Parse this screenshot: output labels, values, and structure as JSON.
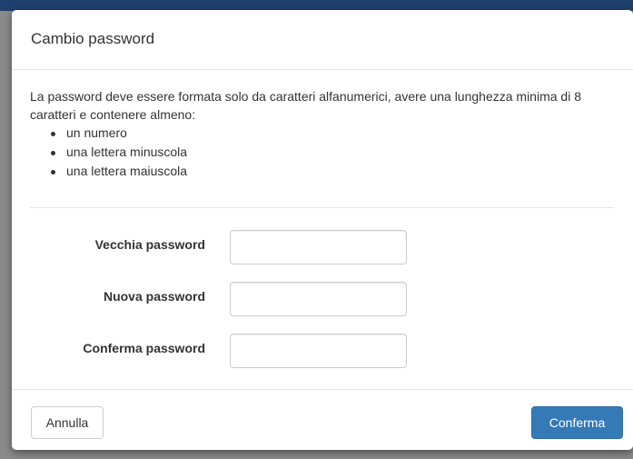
{
  "modal": {
    "title": "Cambio password",
    "rules_text": "La password deve essere formata solo da caratteri alfanumerici, avere una lunghezza minima di 8 caratteri e contenere almeno:",
    "rules": [
      "un numero",
      "una lettera minuscola",
      "una lettera maiuscola"
    ]
  },
  "form": {
    "old_password": {
      "label": "Vecchia password",
      "value": ""
    },
    "new_password": {
      "label": "Nuova password",
      "value": ""
    },
    "confirm_password": {
      "label": "Conferma password",
      "value": ""
    }
  },
  "footer": {
    "cancel_label": "Annulla",
    "confirm_label": "Conferma"
  },
  "colors": {
    "primary": "#337ab7",
    "backdrop_bar": "#1f3f6e"
  }
}
